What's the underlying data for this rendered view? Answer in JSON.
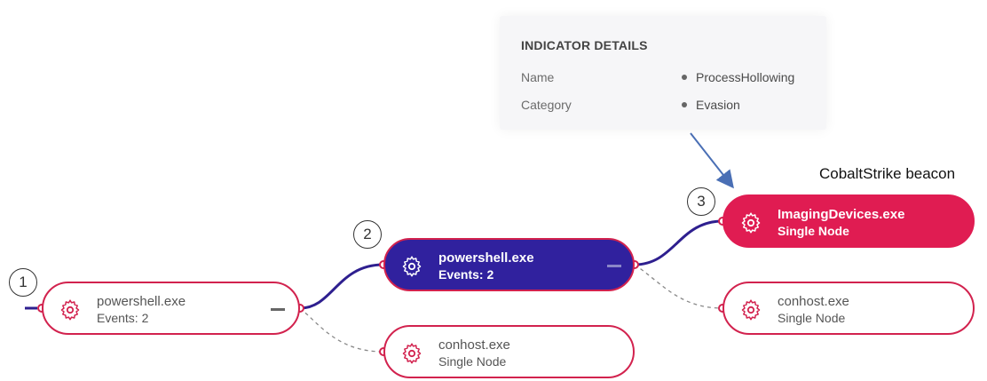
{
  "indicator": {
    "title": "INDICATOR DETAILS",
    "rows": [
      {
        "label": "Name",
        "value": "ProcessHollowing"
      },
      {
        "label": "Category",
        "value": "Evasion"
      }
    ]
  },
  "annotation": "CobaltStrike beacon",
  "steps": [
    "1",
    "2",
    "3"
  ],
  "nodes": {
    "root": {
      "name": "powershell.exe",
      "sub": "Events: 2"
    },
    "child": {
      "name": "powershell.exe",
      "sub": "Events: 2"
    },
    "conhost_a": {
      "name": "conhost.exe",
      "sub": "Single Node"
    },
    "imaging": {
      "name": "ImagingDevices.exe",
      "sub": "Single Node"
    },
    "conhost_b": {
      "name": "conhost.exe",
      "sub": "Single Node"
    }
  },
  "colors": {
    "accent": "#d2224e",
    "active_node": "#30219e",
    "alert_node": "#e01c52",
    "edge": "#2e1f8f",
    "arrow": "#4a6fb5"
  }
}
